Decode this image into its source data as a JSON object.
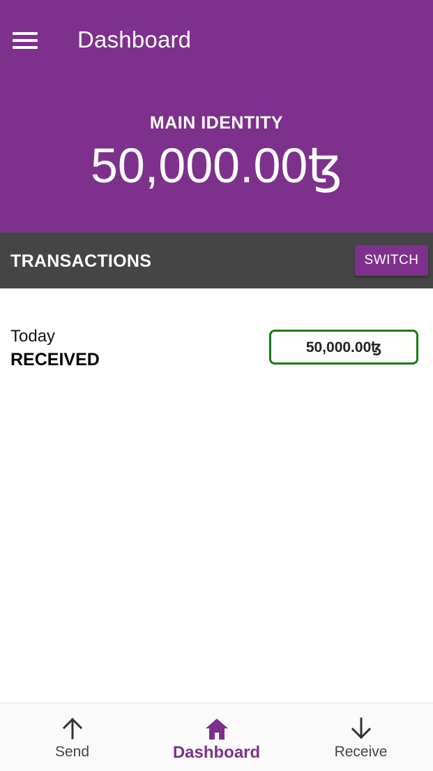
{
  "header": {
    "title": "Dashboard",
    "menu_icon": "hamburger-menu-icon",
    "identity_label": "MAIN IDENTITY",
    "balance": "50,000.00ꜩ"
  },
  "transactions_bar": {
    "title": "TRANSACTIONS",
    "switch_label": "SWITCH"
  },
  "transactions": [
    {
      "date": "Today",
      "type": "RECEIVED",
      "amount": "50,000.00ꜩ"
    }
  ],
  "bottom_nav": {
    "items": [
      {
        "label": "Send",
        "icon": "arrow-up-icon",
        "active": false
      },
      {
        "label": "Dashboard",
        "icon": "home-icon",
        "active": true
      },
      {
        "label": "Receive",
        "icon": "arrow-down-icon",
        "active": false
      }
    ]
  },
  "colors": {
    "brand": "#7e318c",
    "bar": "#454545",
    "received_border": "#1c7a14"
  }
}
